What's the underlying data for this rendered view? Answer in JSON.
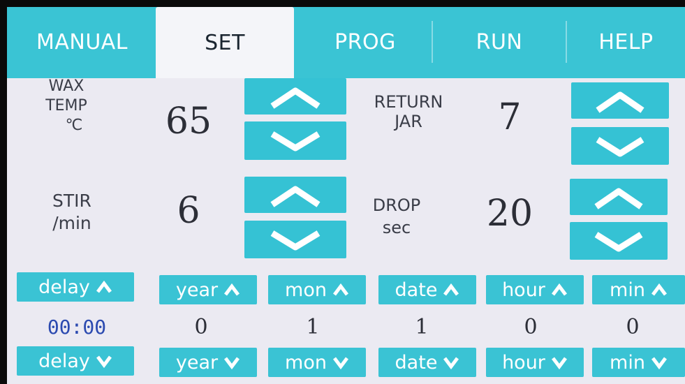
{
  "tabs": [
    {
      "label": "MANUAL"
    },
    {
      "label": "SET",
      "active": true
    },
    {
      "label": "PROG"
    },
    {
      "label": "RUN"
    },
    {
      "label": "HELP"
    }
  ],
  "params": {
    "wax_temp": {
      "label_line1": "WAX",
      "label_line2": "TEMP",
      "label_line3": "℃",
      "value": "65"
    },
    "return_jar": {
      "label_line1": "RETURN",
      "label_line2": "JAR",
      "value": "7"
    },
    "stir": {
      "label_line1": "STIR",
      "label_line2": "/min",
      "value": "6"
    },
    "drop": {
      "label_line1": "DROP",
      "label_line2": "sec",
      "value": "20"
    }
  },
  "timers": [
    {
      "key": "delay",
      "up_label": "delay",
      "down_label": "delay",
      "value": "00:00"
    },
    {
      "key": "year",
      "up_label": "year",
      "down_label": "year",
      "value": "0"
    },
    {
      "key": "mon",
      "up_label": "mon",
      "down_label": "mon",
      "value": "1"
    },
    {
      "key": "date",
      "up_label": "date",
      "down_label": "date",
      "value": "1"
    },
    {
      "key": "hour",
      "up_label": "hour",
      "down_label": "hour",
      "value": "0"
    },
    {
      "key": "min",
      "up_label": "min",
      "down_label": "min",
      "value": "0"
    }
  ],
  "colors": {
    "accent": "#3ac4d4",
    "tab_active_bg": "#f4f5f9",
    "screen_bg": "#ebeaf2",
    "delay_value": "#2b4ab0"
  },
  "icons": {
    "arrow_up": "chevron-up-icon",
    "arrow_down": "chevron-down-icon"
  }
}
